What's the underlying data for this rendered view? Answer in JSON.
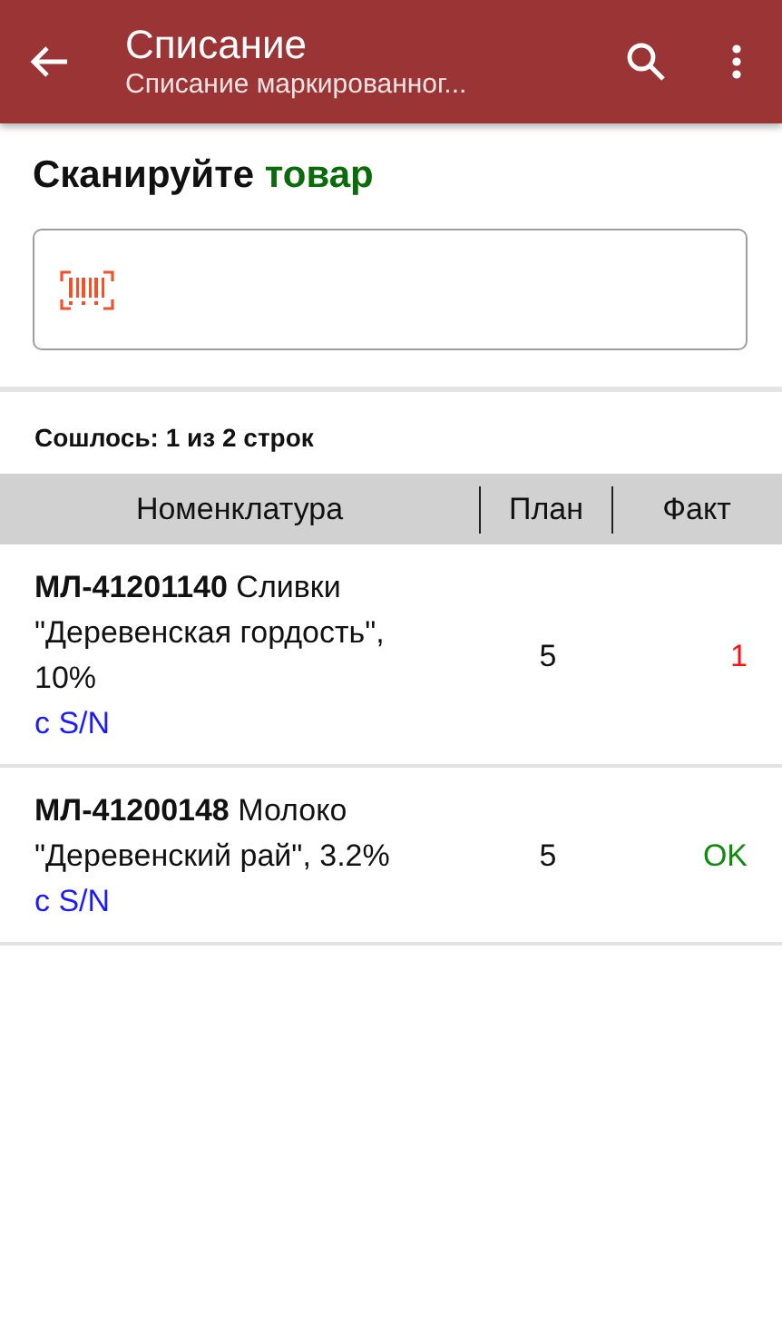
{
  "app_bar": {
    "title": "Списание",
    "subtitle": "Списание маркированног..."
  },
  "prompt": {
    "text": "Сканируйте",
    "highlight": "товар"
  },
  "scan_field": {
    "kind": "barcode"
  },
  "summary": "Сошлось: 1 из 2 строк",
  "table": {
    "columns": [
      "Номенклатура",
      "План",
      "Факт"
    ],
    "rows": [
      {
        "name": "**МЛ-41201140** Сливки \"Деревенская гордость\", 10%",
        "serial": "с S/N",
        "plan": "5",
        "fact": "1",
        "color": "#ff1010"
      },
      {
        "name": "**МЛ-41200148** Молоко \"Деревенский рай\", 3.2%",
        "serial": "с S/N",
        "plan": "5",
        "fact": "OK",
        "color": "#108a10"
      }
    ]
  }
}
